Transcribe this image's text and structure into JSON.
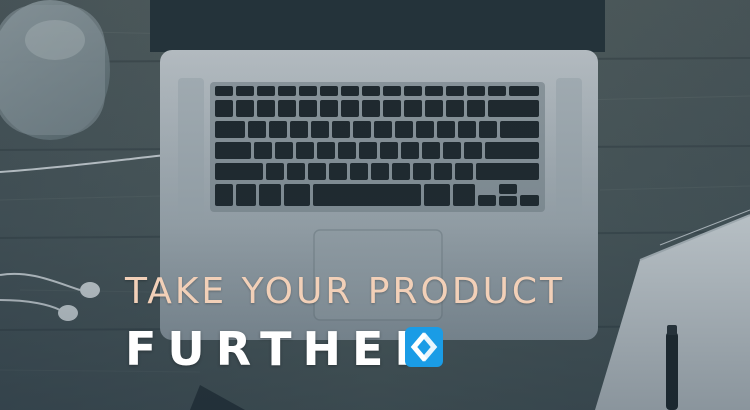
{
  "headline": {
    "line1": "TAKE YOUR PRODUCT",
    "line2": "FURTHER"
  },
  "colors": {
    "line1": "#f2d0b8",
    "line2": "#ffffff",
    "logo_blue": "#1a9ce6",
    "overlay_tint": "#2d4a5e"
  },
  "icons": {
    "logo": "brand-logo-icon"
  }
}
